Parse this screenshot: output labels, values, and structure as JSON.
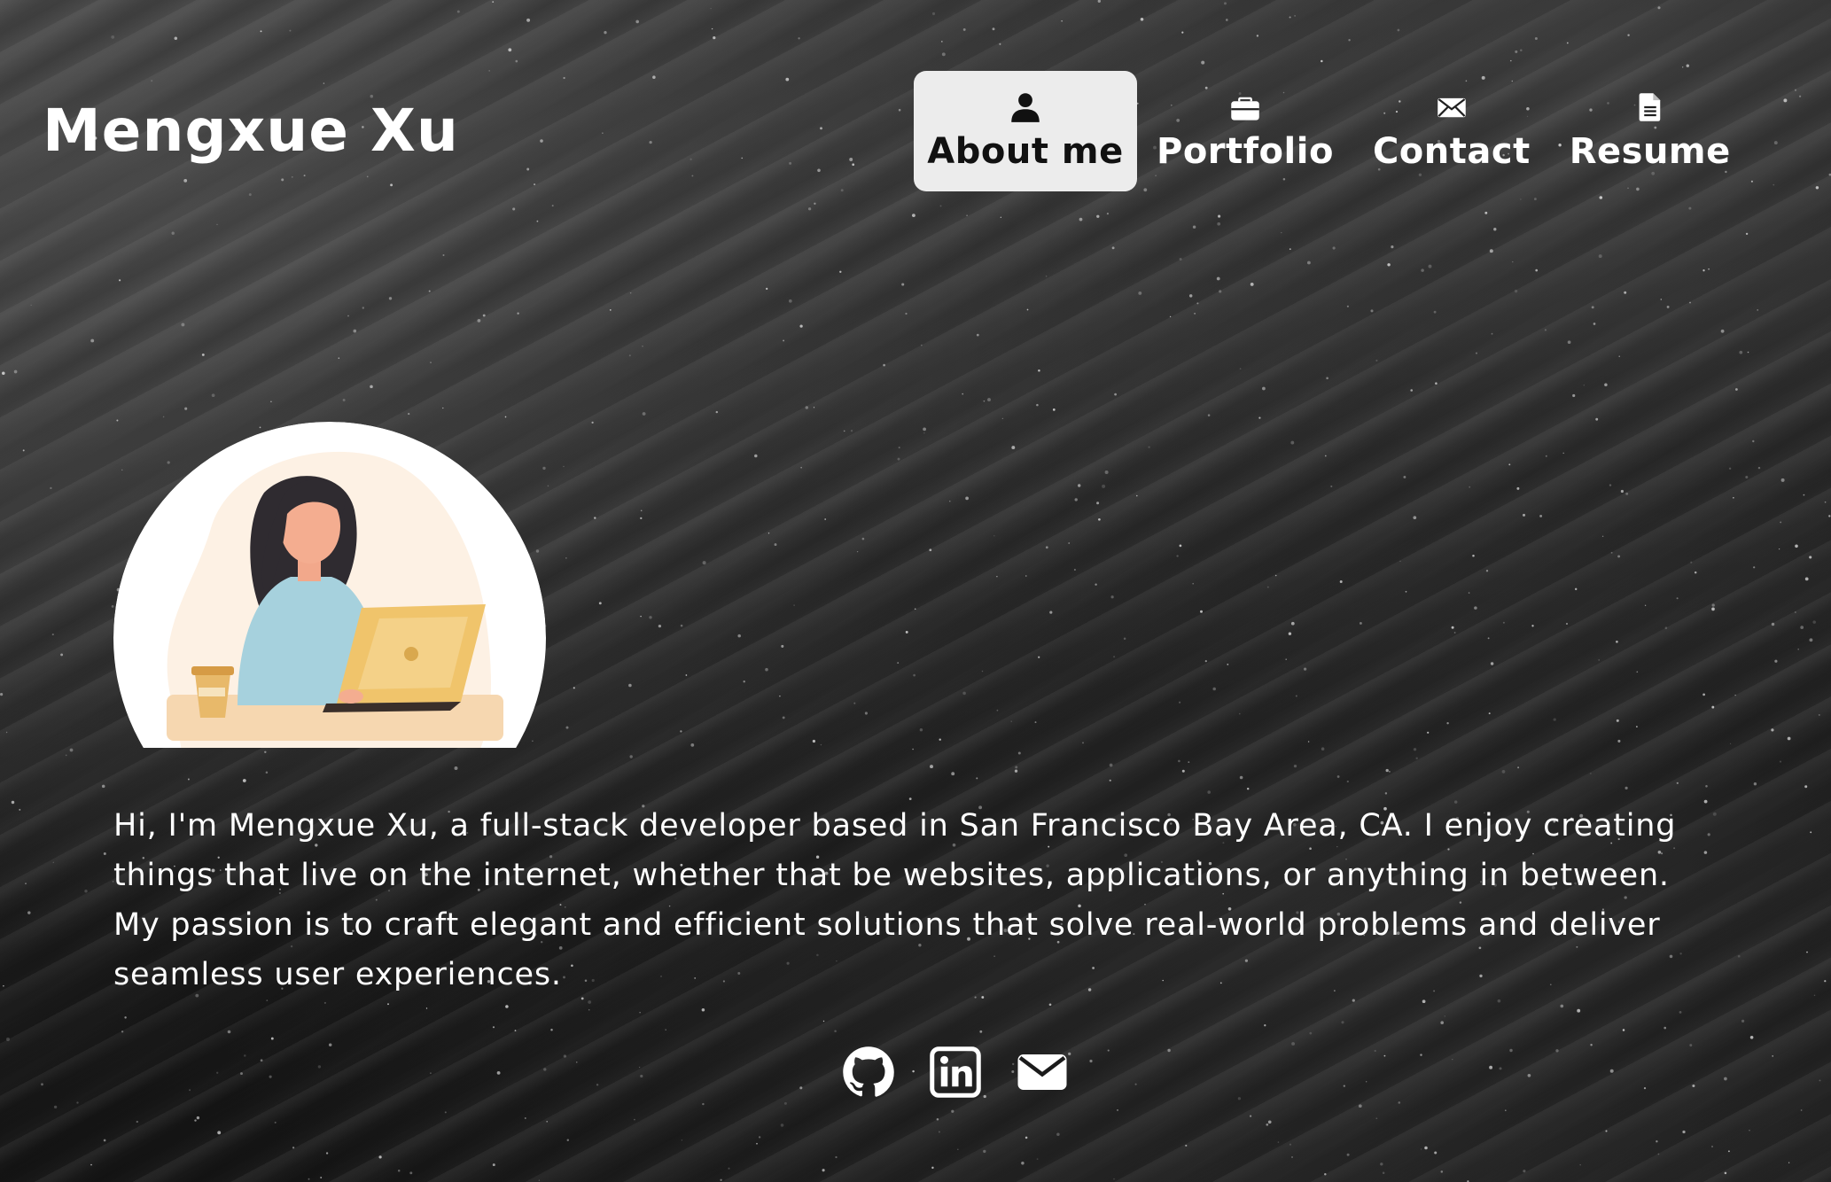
{
  "header": {
    "brand": "Mengxue Xu"
  },
  "nav": {
    "items": [
      {
        "label": "About me",
        "icon": "user-icon",
        "active": true
      },
      {
        "label": "Portfolio",
        "icon": "briefcase-icon",
        "active": false
      },
      {
        "label": "Contact",
        "icon": "envelope-icon",
        "active": false
      },
      {
        "label": "Resume",
        "icon": "document-icon",
        "active": false
      }
    ]
  },
  "avatar": {
    "icon": "developer-illustration-icon"
  },
  "bio": {
    "text": "Hi, I'm Mengxue Xu, a full-stack developer based in San Francisco Bay Area, CA. I enjoy creating things that live on the internet, whether that be websites, applications, or anything in between. My passion is to craft elegant and efficient solutions that solve real-world problems and deliver seamless user experiences."
  },
  "social": {
    "items": [
      {
        "icon": "github-icon"
      },
      {
        "icon": "linkedin-icon"
      },
      {
        "icon": "email-icon"
      }
    ]
  },
  "colors": {
    "active_nav_bg": "#ececec",
    "active_nav_text": "#111111",
    "text": "#ffffff",
    "background": "#1b1b1b"
  }
}
